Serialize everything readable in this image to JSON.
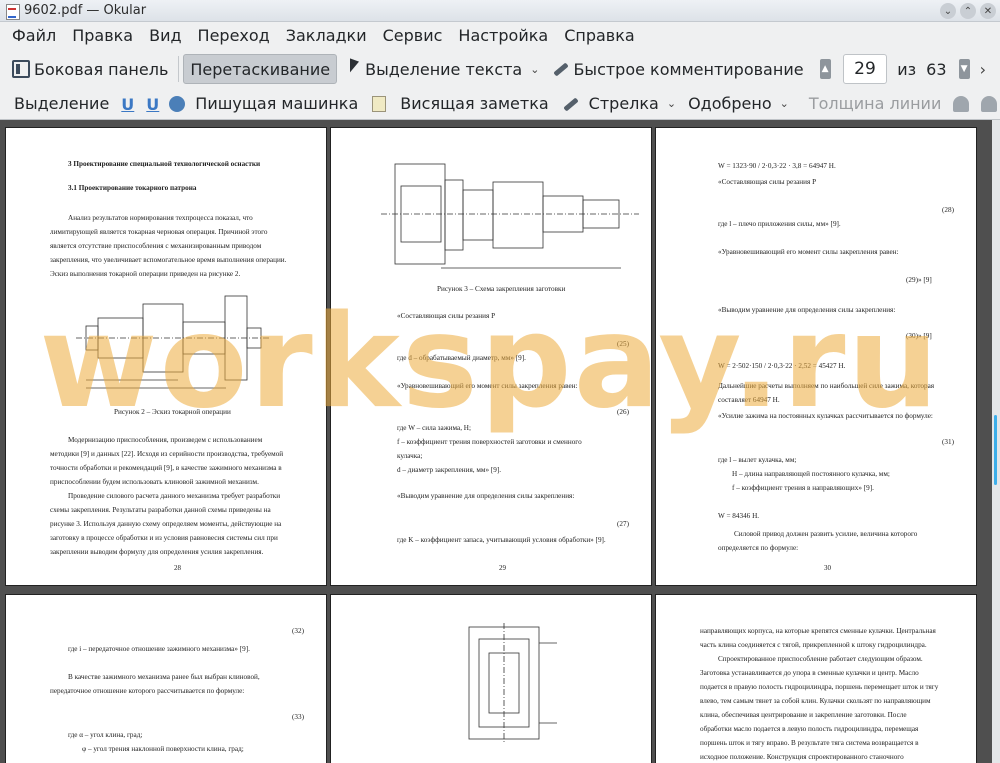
{
  "window": {
    "title": "9602.pdf  — Okular"
  },
  "menu": [
    "Файл",
    "Правка",
    "Вид",
    "Переход",
    "Закладки",
    "Сервис",
    "Настройка",
    "Справка"
  ],
  "toolbar1": {
    "sidebar": "Боковая панель",
    "drag": "Перетаскивание",
    "text_select": "Выделение текста",
    "quick_comment": "Быстрое комментирование",
    "page_current": "29",
    "page_of": "из",
    "page_total": "63"
  },
  "toolbar2": {
    "select": "Выделение",
    "typewriter": "Пишущая машинка",
    "hanging_note": "Висящая заметка",
    "arrow": "Стрелка",
    "approved": "Одобрено",
    "line_width": "Толщина линии"
  },
  "watermark": "workspay.ru",
  "pages": {
    "p28": {
      "heading1": "3 Проектирование специальной технологической оснастки",
      "heading2": "3.1 Проектирование токарного патрона",
      "lines1": [
        "Анализ результатов нормирования техпроцесса показал, что",
        "лимитирующей является токарная черновая операция. Причиной этого",
        "является отсутствие приспособления с механизированным приводом",
        "закрепления, что увеличивает вспомогательное время выполнения операции.",
        "Эскиз выполнения токарной операции приведен на рисунке 2."
      ],
      "caption": "Рисунок 2 – Эскиз токарной операции",
      "lines2": [
        "Модернизацию приспособления, произведем с использованием",
        "методики [9] и данных [22]. Исходя из серийности производства, требуемой",
        "точности обработки и рекомендаций [9], в качестве зажимного механизма в",
        "приспособлении будем использовать клиновой зажимной механизм.",
        "Проведение силового расчета данного механизма требует разработки",
        "схемы закрепления. Результаты разработки данной схемы приведены на",
        "рисунке 3. Используя данную схему определяем моменты, действующие на",
        "заготовку в процессе обработки и из условия равновесия системы сил при",
        "закреплении выводим формулу для определения усилия закрепления."
      ],
      "number": "28"
    },
    "p29": {
      "caption": "Рисунок 3 – Схема закрепления заготовки",
      "lines": [
        "«Составляющая силы резания P",
        "где d – обрабатываемый диаметр, мм» [9].",
        "«Уравновешивающий его момент силы закрепления равен:",
        "где W – сила зажима, Н;",
        "f – коэффициент трения поверхностей заготовки и сменного",
        "кулачка;",
        "d – диаметр закрепления, мм» [9].",
        "«Выводим уравнение для определения силы закрепления:",
        "где K – коэффициент запаса, учитывающий условия обработки» [9]."
      ],
      "eq_nums": [
        "(25)",
        "(26)",
        "(27)"
      ],
      "number": "29"
    },
    "p30": {
      "lines": [
        "W = 1323·90 / 2·0,3·22 · 3,8 = 64947 Н.",
        "«Составляющая силы резания P",
        "где l – плечо приложения силы, мм» [9].",
        "«Уравновешивающий его момент силы закрепления равен:",
        "«Выводим уравнение для определения силы закрепления:",
        "W = 2·502·150 / 2·0,3·22 · 2,52 = 45427 Н.",
        "Дальнейшие расчеты выполняем по наибольшей силе зажима, которая",
        "составляет 64947 Н.",
        "«Усилие зажима на постоянных кулачках рассчитывается по формуле:",
        "где l – вылет кулачка, мм;",
        "H – длина направляющей постоянного кулачка, мм;",
        "f – коэффициент трения в направляющих» [9].",
        "W = 84346 Н.",
        "Силовой привод должен развить усилие, величина которого",
        "определяется по формуле:"
      ],
      "eq_nums": [
        "(28)",
        "(29)» [9]",
        "(30)» [9]",
        "(31)"
      ],
      "number": "30"
    },
    "p31": {
      "lines": [
        "где i – передаточное отношение зажимного механизма» [9].",
        "В качестве зажимного механизма ранее был выбран клиновой,",
        "передаточное отношение которого рассчитывается по формуле:",
        "где α – угол клина, град;",
        "φ – угол трения наклонной поверхности клина, град;"
      ],
      "eq_nums": [
        "(32)",
        "(33)"
      ]
    },
    "p33": {
      "lines": [
        "направляющих корпуса, на которые крепятся сменные кулачки. Центральная",
        "часть клина соединяется с тягой, прикрепленной к штоку гидроцилиндра.",
        "Спроектированное приспособление работает следующим образом.",
        "Заготовка устанавливается до упора в сменные кулачки и центр. Масло",
        "подается в правую полость гидроцилиндра, поршень перемещает шток и тягу",
        "влево, тем самым тянет за собой клин. Кулачки скользят по направляющим",
        "клина, обеспечивая центрирование и закрепление заготовки. После",
        "обработки масло подается в левую полость гидроцилиндра, перемещая",
        "поршень шток и тягу вправо. В результате тяга система возвращается в",
        "исходное положение. Конструкция спроектированного станочного"
      ]
    }
  }
}
